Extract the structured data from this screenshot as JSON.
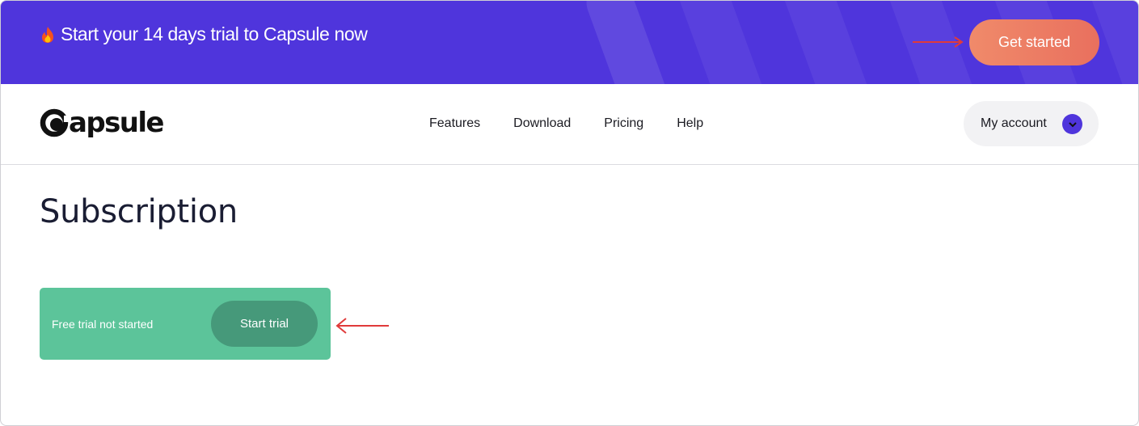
{
  "banner": {
    "text": "Start your 14 days trial to Capsule now",
    "cta_label": "Get started",
    "background": "#4f35dc",
    "cta_color": "#ec7c64"
  },
  "header": {
    "logo_text": "apsule",
    "nav": [
      {
        "label": "Features"
      },
      {
        "label": "Download"
      },
      {
        "label": "Pricing"
      },
      {
        "label": "Help"
      }
    ],
    "account_label": "My account",
    "accent": "#4f35dc"
  },
  "main": {
    "title": "Subscription",
    "trial_card": {
      "status_text": "Free trial not started",
      "button_label": "Start trial",
      "background": "#5cc49a",
      "button_color": "#46997a"
    }
  },
  "annotations": {
    "arrow_color": "#e03a3a"
  }
}
